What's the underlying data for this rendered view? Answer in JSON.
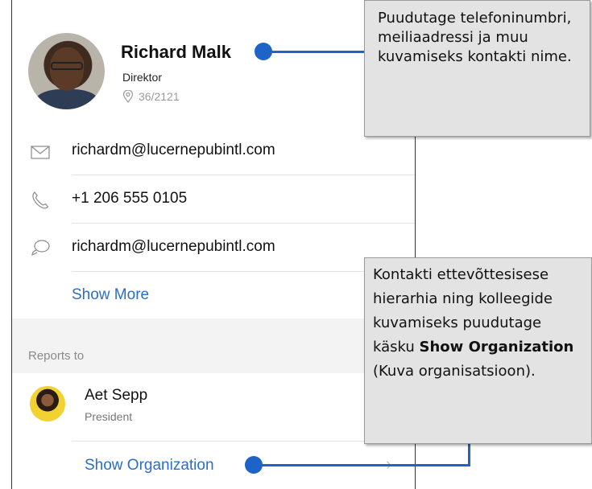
{
  "contact": {
    "name": "Richard Malk",
    "title": "Direktor",
    "location": "36/2121"
  },
  "details": [
    {
      "icon": "mail-icon",
      "text": "richardm@lucernepubintl.com"
    },
    {
      "icon": "phone-icon",
      "text": "+1 206 555 0105"
    },
    {
      "icon": "chat-icon",
      "text": "richardm@lucernepubintl.com"
    }
  ],
  "show_more": "Show More",
  "reports_to": {
    "label": "Reports to",
    "name": "Aet Sepp",
    "role": "President"
  },
  "show_org": "Show Organization",
  "callouts": {
    "one": "Puudutage telefoninumbri, meiliaadressi ja muu kuvamiseks kontakti nime.",
    "two_prefix": "Kontakti ettevõttesisese hierarhia ning kolleegide kuvamiseks puudutage käsku",
    "two_bold": "Show Organization",
    "two_suffix": "(Kuva organisatsioon)."
  },
  "colors": {
    "accent": "#1e64c8",
    "link": "#2a6ec6"
  }
}
